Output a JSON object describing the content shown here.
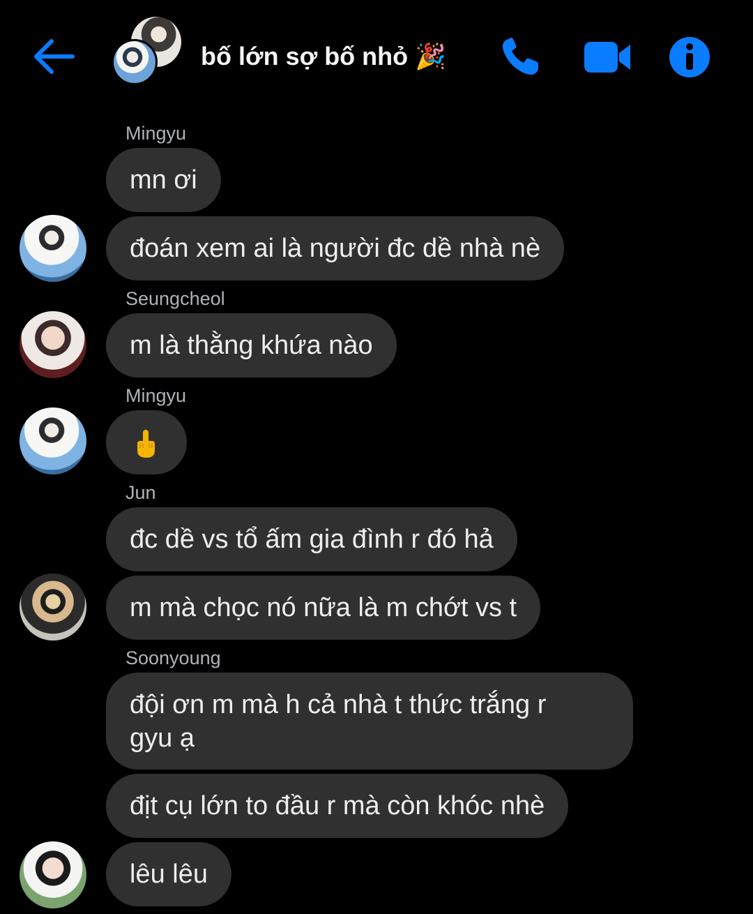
{
  "header": {
    "title": "bố lớn sợ bố nhỏ 🎉",
    "back_icon": "back-arrow-icon",
    "phone_icon": "phone-icon",
    "video_icon": "video-camera-icon",
    "info_icon": "info-icon",
    "accent_color": "#0a7cff"
  },
  "messages": {
    "m1_sender": "Mingyu",
    "m1_text": "mn ơi",
    "m2_text": "đoán xem ai là người đc dề nhà nè",
    "m3_sender": "Seungcheol",
    "m3_text": "m là thằng khứa nào",
    "m4_sender": "Mingyu",
    "m4_icon": "middle-finger-emoji-icon",
    "m5_sender": "Jun",
    "m5_text": "đc dề vs tổ ấm gia đình r đó hả",
    "m6_text": "m mà chọc nó nữa là m chớt vs t",
    "m7_sender": "Soonyoung",
    "m7_text_line1": "đội ơn m mà h cả nhà t thức trắng r",
    "m7_text_line2": "gyu ạ",
    "m8_text": "địt cụ lớn to đầu r mà còn khóc nhè",
    "m9_text": "lêu lêu"
  },
  "colors": {
    "background": "#000000",
    "bubble": "#303030",
    "sender_label": "#b0b3b8"
  }
}
